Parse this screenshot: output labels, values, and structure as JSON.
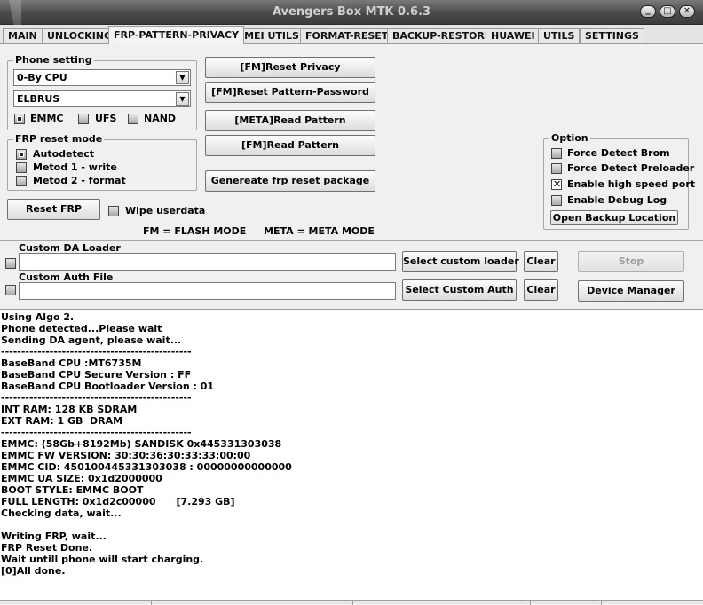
{
  "window": {
    "title": "Avengers Box MTK 0.6.3",
    "minimize_glyph": "_",
    "restore_glyph": "□",
    "close_glyph": "✕"
  },
  "tabs": [
    {
      "label": "MAIN",
      "active": false
    },
    {
      "label": "UNLOCKING",
      "active": false
    },
    {
      "label": "FRP-PATTERN-PRIVACY",
      "active": true
    },
    {
      "label": "IMEI UTILS",
      "active": false
    },
    {
      "label": "FORMAT-RESET",
      "active": false
    },
    {
      "label": "BACKUP-RESTORE",
      "active": false
    },
    {
      "label": "HUAWEI",
      "active": false
    },
    {
      "label": "UTILS",
      "active": false
    },
    {
      "label": "SETTINGS",
      "active": false
    }
  ],
  "phone_setting": {
    "legend": "Phone setting",
    "cpu_select": "0-By CPU",
    "model_select": "ELBRUS",
    "storage_options": [
      {
        "label": "EMMC",
        "selected": true
      },
      {
        "label": "UFS",
        "selected": false
      },
      {
        "label": "NAND",
        "selected": false
      }
    ]
  },
  "frp_mode": {
    "legend": "FRP reset mode",
    "options": [
      {
        "label": "Autodetect",
        "selected": true
      },
      {
        "label": "Metod 1 - write",
        "selected": false
      },
      {
        "label": "Metod 2 - format",
        "selected": false
      }
    ]
  },
  "actions": {
    "reset_frp": "Reset FRP",
    "wipe_userdata": "Wipe userdata",
    "wipe_userdata_checked": false,
    "fm_reset_privacy": "[FM]Reset Privacy",
    "fm_reset_pattern": "[FM]Reset Pattern-Password",
    "meta_read_pattern": "[META]Read Pattern",
    "fm_read_pattern": "[FM]Read Pattern",
    "generate_package": "Genereate frp reset package"
  },
  "legend_text": {
    "fm": "FM = FLASH MODE",
    "meta": "META = META MODE"
  },
  "option": {
    "legend": "Option",
    "checkboxes": [
      {
        "label": "Force Detect Brom",
        "checked": false
      },
      {
        "label": "Force Detect Preloader",
        "checked": false
      },
      {
        "label": "Enable high speed port",
        "checked": true
      },
      {
        "label": "Enable Debug Log",
        "checked": false
      }
    ],
    "open_backup": "Open Backup Location"
  },
  "loaders": {
    "da_label": "Custom DA Loader",
    "da_value": "",
    "da_button": "Select custom loader",
    "auth_label": "Custom Auth File",
    "auth_value": "",
    "auth_button": "Select Custom Auth",
    "clear": "Clear",
    "stop": "Stop",
    "device_manager": "Device Manager"
  },
  "log": [
    "Using Algo 2.",
    "Phone detected...Please wait",
    "Sending DA agent, please wait...",
    "-----------------------------------------------",
    "BaseBand CPU :MT6735M",
    "BaseBand CPU Secure Version : FF",
    "BaseBand CPU Bootloader Version : 01",
    "-----------------------------------------------",
    "INT RAM: 128 KB SDRAM",
    "EXT RAM: 1 GB  DRAM",
    "-----------------------------------------------",
    "EMMC: (58Gb+8192Mb) SANDISK 0x445331303038",
    "EMMC FW VERSION: 30:30:36:30:33:33:00:00",
    "EMMC CID: 450100445331303038 : 00000000000000",
    "EMMC UA SIZE: 0x1d2000000",
    "BOOT STYLE: EMMC BOOT",
    "FULL LENGTH: 0x1d2c00000      [7.293 GB]",
    "Checking data, wait...",
    "",
    "Writing FRP, wait...",
    "FRP Reset Done.",
    "Wait untill phone will start charging.",
    "[0]All done."
  ]
}
